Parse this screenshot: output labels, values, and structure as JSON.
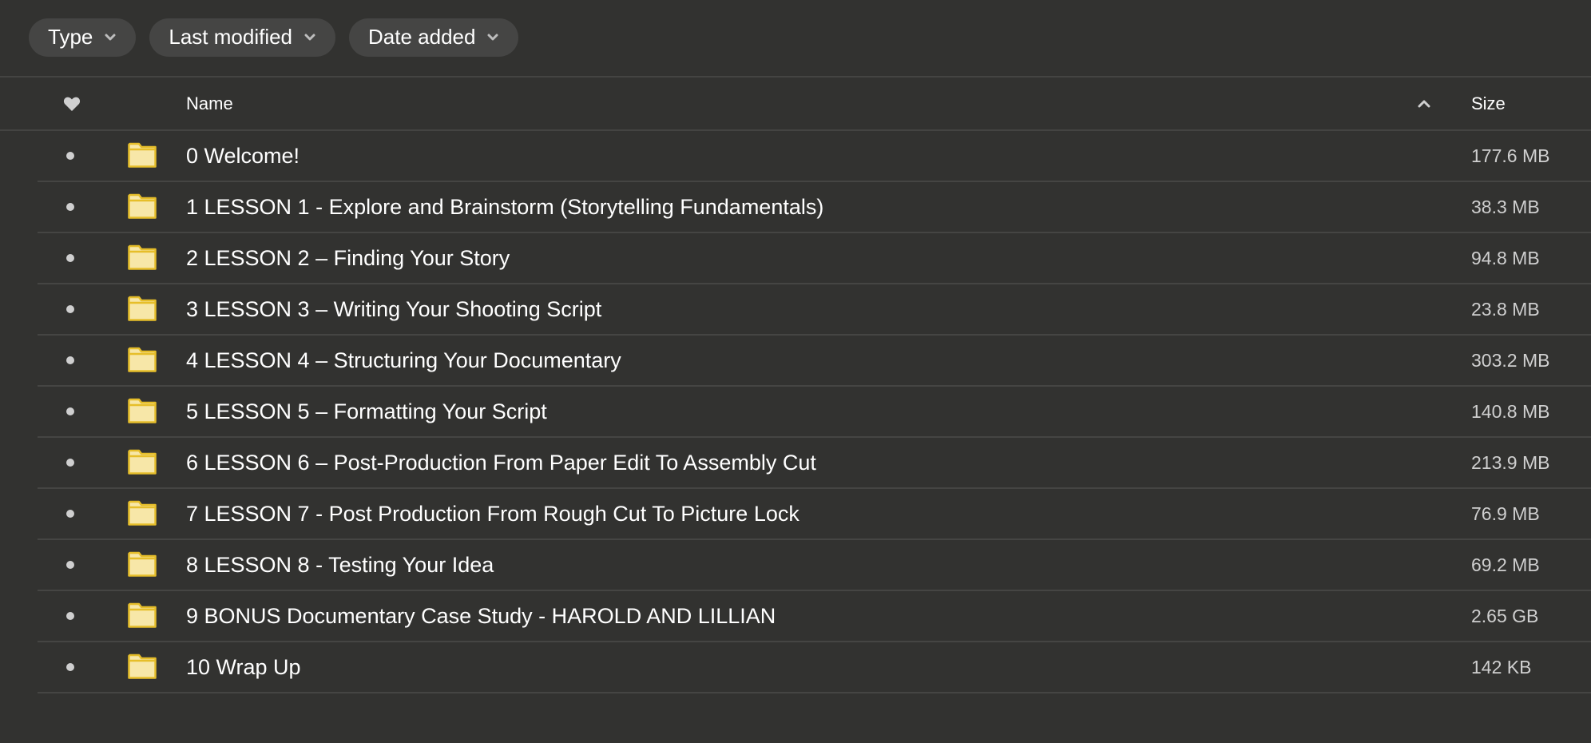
{
  "filters": [
    {
      "label": "Type",
      "icon": "chevron-down-icon"
    },
    {
      "label": "Last modified",
      "icon": "chevron-down-icon"
    },
    {
      "label": "Date added",
      "icon": "chevron-down-icon"
    }
  ],
  "table": {
    "columns": {
      "favorite_icon": "heart-icon",
      "name": "Name",
      "sort_icon": "chevron-up-icon",
      "size": "Size"
    },
    "rows": [
      {
        "name": "0 Welcome!",
        "size": "177.6 MB",
        "type": "folder"
      },
      {
        "name": "1 LESSON 1 - Explore and Brainstorm (Storytelling Fundamentals)",
        "size": "38.3 MB",
        "type": "folder"
      },
      {
        "name": "2 LESSON 2 – Finding Your Story",
        "size": "94.8 MB",
        "type": "folder"
      },
      {
        "name": "3 LESSON 3 – Writing Your Shooting Script",
        "size": "23.8 MB",
        "type": "folder"
      },
      {
        "name": "4 LESSON 4 – Structuring Your Documentary",
        "size": "303.2 MB",
        "type": "folder"
      },
      {
        "name": "5 LESSON 5 – Formatting Your Script",
        "size": "140.8 MB",
        "type": "folder"
      },
      {
        "name": "6 LESSON 6 – Post-Production From Paper Edit To Assembly Cut",
        "size": "213.9 MB",
        "type": "folder"
      },
      {
        "name": "7 LESSON 7 - Post Production From Rough Cut To Picture Lock",
        "size": "76.9 MB",
        "type": "folder"
      },
      {
        "name": "8 LESSON 8 - Testing Your Idea",
        "size": "69.2 MB",
        "type": "folder"
      },
      {
        "name": "9 BONUS Documentary Case Study - HAROLD AND LILLIAN",
        "size": "2.65 GB",
        "type": "folder"
      },
      {
        "name": "10 Wrap Up",
        "size": "142 KB",
        "type": "folder"
      }
    ]
  },
  "colors": {
    "background": "#323230",
    "pill": "#454544",
    "divider": "#444442",
    "folder_fill": "#f7e7a8",
    "folder_stroke": "#e6be2a",
    "bullet": "#cfcfcf"
  }
}
